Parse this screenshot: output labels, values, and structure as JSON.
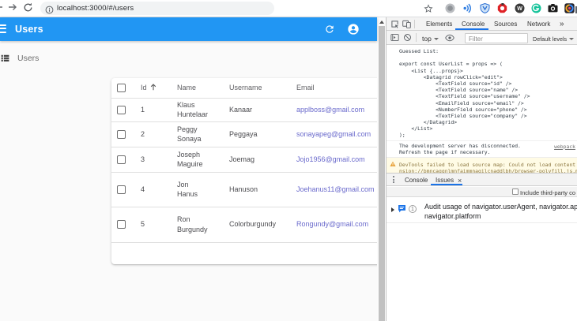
{
  "browser": {
    "url": "localhost:3000/#/users",
    "icons": [
      "back-icon",
      "forward-icon",
      "reload-icon",
      "site-info-icon",
      "bookmark-star-icon"
    ],
    "extensions": [
      "gray-circle-extension-icon",
      "sound-waves-extension-icon",
      "blue-shield-extension-icon",
      "red-ring-extension-icon",
      "dark-w-extension-icon",
      "green-circle-extension-icon",
      "camera-extension-icon",
      "photo-gradient-extension-icon",
      "puzzle-extensions-icon"
    ]
  },
  "app": {
    "appbar": {
      "title": "Users",
      "color": "#2196f3",
      "icons": [
        "menu-icon",
        "refresh-icon",
        "account-circle-icon"
      ]
    },
    "sidebar": {
      "items": [
        {
          "label": "Users",
          "icon": "view-list-icon"
        }
      ]
    },
    "table": {
      "columns": {
        "id": "Id",
        "name": "Name",
        "username": "Username",
        "email": "Email"
      },
      "sort": {
        "column": "Id",
        "direction": "ascending",
        "arrow": "↑"
      },
      "email_link_color": "#6a6acc",
      "rows": [
        {
          "id": "1",
          "name": "Klaus Huntelaar",
          "username": "Kanaar",
          "email": "applboss@gmail.com"
        },
        {
          "id": "2",
          "name": "Peggy Sonaya",
          "username": "Peggaya",
          "email": "sonayapeg@gmail.com"
        },
        {
          "id": "3",
          "name": "Joseph Maguire",
          "username": "Joemag",
          "email": "Jojo1956@gmail.com"
        },
        {
          "id": "4",
          "name": "Jon Hanus",
          "username": "Hanuson",
          "email": "Joehanus11@gmail.com"
        },
        {
          "id": "5",
          "name": "Ron Burgundy",
          "username": "Colorburgundy",
          "email": "Rongundy@gmail.com"
        }
      ]
    }
  },
  "devtools": {
    "accent_color": "#1a73e8",
    "tabs": {
      "elements": "Elements",
      "console": "Console",
      "sources": "Sources",
      "network": "Network",
      "more": "»"
    },
    "active_tab": "Console",
    "toolbar": {
      "context": "top",
      "filter_placeholder": "Filter",
      "levels": "Default levels"
    },
    "console": {
      "log_lines": [
        "Guessed List:",
        "",
        "export const UserList = props => (",
        "    <List {...props}>",
        "        <Datagrid rowClick=\"edit\">",
        "            <TextField source=\"id\" />",
        "            <TextField source=\"name\" />",
        "            <TextField source=\"username\" />",
        "            <EmailField source=\"email\" />",
        "            <NumberField source=\"phone\" />",
        "            <TextField source=\"company\" />",
        "        </Datagrid>",
        "    </List>",
        ");"
      ],
      "disconnect_line1": "The development server has disconnected.",
      "disconnect_line2": "Refresh the page if necessary.",
      "disconnect_link": "webpack",
      "warning_line1": "DevTools failed to load source map: Could not load content",
      "warning_line2": "nsion://bmncaggnlmnfaimmnagilcnaddlbh/browser-polyfill.js.m",
      "warning_bg": "#fffbe5"
    },
    "drawer": {
      "tabs": {
        "console": "Console",
        "issues": "Issues"
      },
      "active_tab": "Issues",
      "close_label": "×",
      "checkbox_label": "Include third-party co",
      "issue": {
        "count": "1",
        "line1": "Audit usage of navigator.userAgent, navigator.appVersion,",
        "line2": "navigator.platform"
      }
    }
  }
}
